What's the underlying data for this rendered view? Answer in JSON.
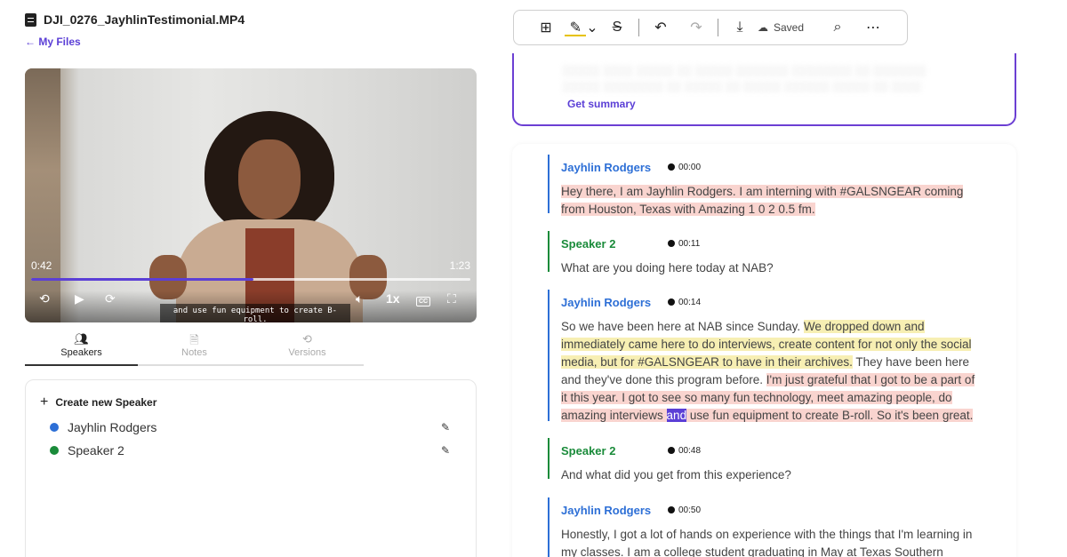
{
  "file": {
    "title": "DJI_0276_JayhlinTestimonial.MP4",
    "back_label": "← My Files"
  },
  "video": {
    "current_time": "0:42",
    "total_time": "1:23",
    "progress_fraction": 0.506,
    "caption": "and use fun equipment to create B-roll.",
    "speed": "1x",
    "cc_label": "CC"
  },
  "tabs": [
    {
      "label": "Speakers",
      "icon": "speakers-icon",
      "active": true
    },
    {
      "label": "Notes",
      "icon": "notes-icon",
      "active": false
    },
    {
      "label": "Versions",
      "icon": "versions-icon",
      "active": false
    }
  ],
  "speakers_panel": {
    "create_label": "Create new Speaker",
    "speakers": [
      {
        "name": "Jayhlin Rodgers",
        "color": "#2d6fd6"
      },
      {
        "name": "Speaker 2",
        "color": "#1a8b3a"
      }
    ]
  },
  "toolbar": {
    "saved_label": "Saved"
  },
  "summary": {
    "get_summary_label": "Get summary"
  },
  "colors": {
    "accent": "#5b3fd6",
    "speaker1": "#2d6fd6",
    "speaker2": "#1a8b3a",
    "highlight_red": "#f9d4cf",
    "highlight_yellow": "#f7efb3"
  },
  "transcript": [
    {
      "speaker": "Jayhlin Rodgers",
      "time": "00:00",
      "parts": [
        {
          "t": "Hey there, I am Jayhlin Rodgers. I am interning with #GALSNGEAR coming from Houston, Texas with Amazing 1 0 2 0.5 fm.",
          "hl": "red"
        }
      ]
    },
    {
      "speaker": "Speaker 2",
      "time": "00:11",
      "parts": [
        {
          "t": "What are you doing here today at NAB?",
          "hl": ""
        }
      ]
    },
    {
      "speaker": "Jayhlin Rodgers",
      "time": "00:14",
      "parts": [
        {
          "t": "So we have been here at NAB since Sunday. ",
          "hl": ""
        },
        {
          "t": "We dropped down and immediately came here to do interviews, create content for not only the social media, but for #GALSNGEAR to have in their archives.",
          "hl": "yellow"
        },
        {
          "t": " They have been here and they've done this program before. ",
          "hl": ""
        },
        {
          "t": "I'm just grateful that I got to be a part of it this year. I got to see so many fun technology, meet amazing people, do amazing interviews ",
          "hl": "red"
        },
        {
          "t": "and",
          "hl": "current"
        },
        {
          "t": " use fun equipment to create B-roll. So it's been great.",
          "hl": "red"
        }
      ]
    },
    {
      "speaker": "Speaker 2",
      "time": "00:48",
      "parts": [
        {
          "t": "And what did you get from this experience?",
          "hl": ""
        }
      ]
    },
    {
      "speaker": "Jayhlin Rodgers",
      "time": "00:50",
      "parts": [
        {
          "t": "Honestly, I got a lot of hands on experience with the things that I'm learning in my classes. I am a college student graduating in May at Texas Southern",
          "hl": ""
        }
      ]
    }
  ]
}
